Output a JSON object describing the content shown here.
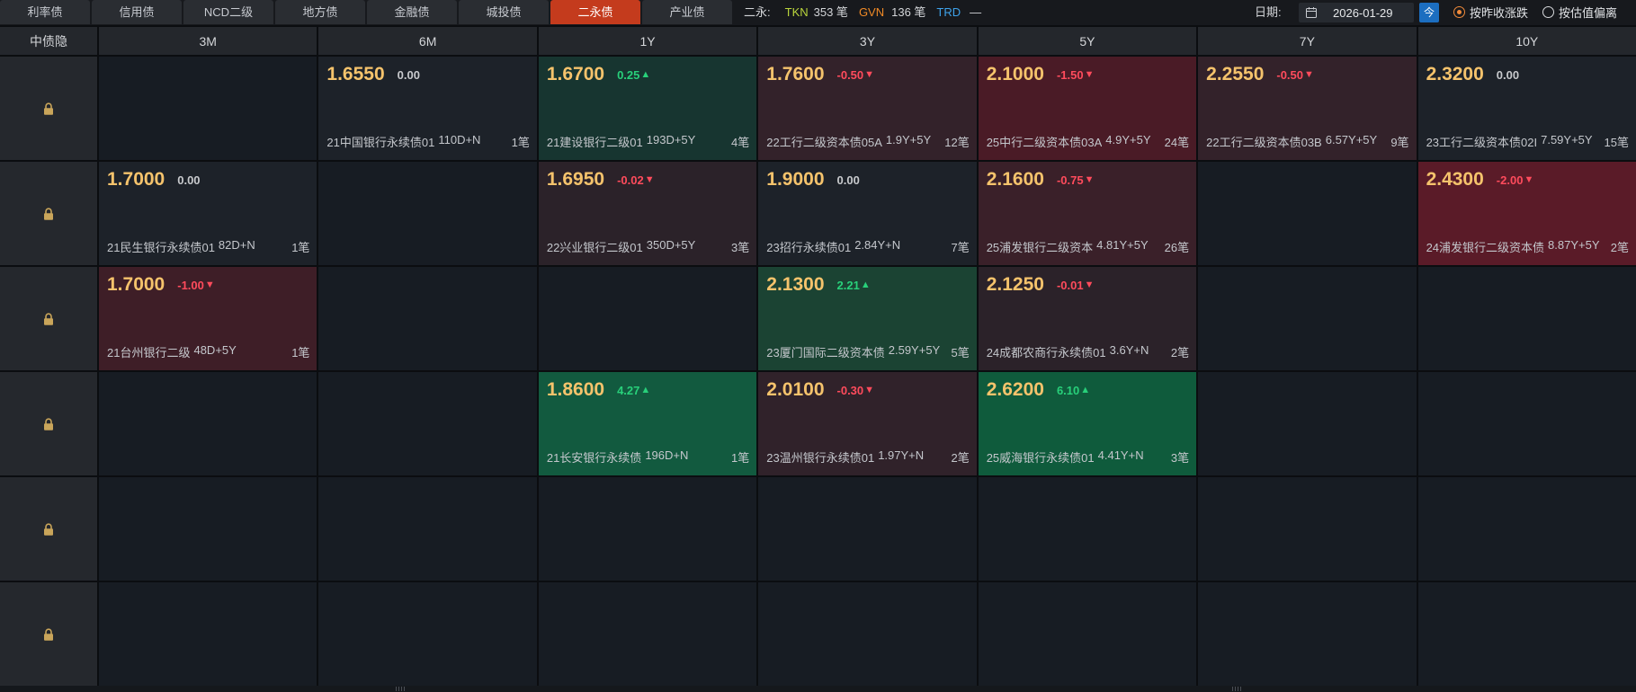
{
  "tabs": [
    {
      "label": "利率债",
      "active": false
    },
    {
      "label": "信用债",
      "active": false
    },
    {
      "label": "NCD二级",
      "active": false
    },
    {
      "label": "地方债",
      "active": false
    },
    {
      "label": "金融债",
      "active": false
    },
    {
      "label": "城投债",
      "active": false
    },
    {
      "label": "二永债",
      "active": true
    },
    {
      "label": "产业债",
      "active": false
    }
  ],
  "summary": {
    "label": "二永:",
    "tkn": {
      "name": "TKN",
      "count": "353 笔",
      "color": "#b9d43c"
    },
    "gvn": {
      "name": "GVN",
      "count": "136 笔",
      "color": "#f08a26"
    },
    "trd": {
      "name": "TRD",
      "value": "—",
      "color": "#3ea2ea"
    }
  },
  "date_picker": {
    "label": "日期:",
    "icon": "calendar-icon",
    "value": "2026-01-29",
    "today_button": "今"
  },
  "mode": {
    "options": [
      {
        "label": "按昨收涨跌",
        "selected": true
      },
      {
        "label": "按估值偏离",
        "selected": false
      }
    ]
  },
  "colors": {
    "accent": "#c43b1d",
    "price": "#f5c36c",
    "up": "#28d07a",
    "down": "#ff4b5c",
    "flat": "#c8cacd",
    "lock": "#c9a55a"
  },
  "grid": {
    "corner_label": "中债隐",
    "row_icon": "lock-icon",
    "columns": [
      "3M",
      "6M",
      "1Y",
      "3Y",
      "5Y",
      "7Y",
      "10Y"
    ],
    "rows": [
      {
        "cells": [
          null,
          {
            "price": "1.6550",
            "change": "0.00",
            "dir": "flat",
            "bond": "21中国银行永续债01",
            "term": "110D+N",
            "count": "1笔",
            "bg": "#1d2229"
          },
          {
            "price": "1.6700",
            "change": "0.25",
            "arrow": "▲",
            "dir": "up",
            "bond": "21建设银行二级01",
            "term": "193D+5Y",
            "count": "4笔",
            "bg": "#173530"
          },
          {
            "price": "1.7600",
            "change": "-0.50",
            "arrow": "▼",
            "dir": "down",
            "bond": "22工行二级资本债05A",
            "term": "1.9Y+5Y",
            "count": "12笔",
            "bg": "#33222a"
          },
          {
            "price": "2.1000",
            "change": "-1.50",
            "arrow": "▼",
            "dir": "down",
            "bond": "25中行二级资本债03A",
            "term": "4.9Y+5Y",
            "count": "24笔",
            "bg": "#4a1b26"
          },
          {
            "price": "2.2550",
            "change": "-0.50",
            "arrow": "▼",
            "dir": "down",
            "bond": "22工行二级资本债03B",
            "term": "6.57Y+5Y",
            "count": "9笔",
            "bg": "#33222a"
          },
          {
            "price": "2.3200",
            "change": "0.00",
            "dir": "flat",
            "bond": "23工行二级资本债02I",
            "term": "7.59Y+5Y",
            "count": "15笔",
            "bg": "#1d2229"
          }
        ]
      },
      {
        "cells": [
          {
            "price": "1.7000",
            "change": "0.00",
            "dir": "flat",
            "bond": "21民生银行永续债01",
            "term": "82D+N",
            "count": "1笔",
            "bg": "#1d2229"
          },
          null,
          {
            "price": "1.6950",
            "change": "-0.02",
            "arrow": "▼",
            "dir": "down",
            "bond": "22兴业银行二级01",
            "term": "350D+5Y",
            "count": "3笔",
            "bg": "#2b2229"
          },
          {
            "price": "1.9000",
            "change": "0.00",
            "dir": "flat",
            "bond": "23招行永续债01",
            "term": "2.84Y+N",
            "count": "7笔",
            "bg": "#1d2229"
          },
          {
            "price": "2.1600",
            "change": "-0.75",
            "arrow": "▼",
            "dir": "down",
            "bond": "25浦发银行二级资本",
            "term": "4.81Y+5Y",
            "count": "26笔",
            "bg": "#3a2029"
          },
          null,
          {
            "price": "2.4300",
            "change": "-2.00",
            "arrow": "▼",
            "dir": "down",
            "bond": "24浦发银行二级资本债",
            "term": "8.87Y+5Y",
            "count": "2笔",
            "bg": "#5a1b28"
          }
        ]
      },
      {
        "cells": [
          {
            "price": "1.7000",
            "change": "-1.00",
            "arrow": "▼",
            "dir": "down",
            "bond": "21台州银行二级",
            "term": "48D+5Y",
            "count": "1笔",
            "bg": "#3e1e27"
          },
          null,
          null,
          {
            "price": "2.1300",
            "change": "2.21",
            "arrow": "▲",
            "dir": "up",
            "bond": "23厦门国际二级资本债",
            "term": "2.59Y+5Y",
            "count": "5笔",
            "bg": "#1b4333"
          },
          {
            "price": "2.1250",
            "change": "-0.01",
            "arrow": "▼",
            "dir": "down",
            "bond": "24成都农商行永续债01",
            "term": "3.6Y+N",
            "count": "2笔",
            "bg": "#2b2229"
          },
          null,
          null
        ]
      },
      {
        "cells": [
          null,
          null,
          {
            "price": "1.8600",
            "change": "4.27",
            "arrow": "▲",
            "dir": "up",
            "bond": "21长安银行永续债",
            "term": "196D+N",
            "count": "1笔",
            "bg": "#125a3f"
          },
          {
            "price": "2.0100",
            "change": "-0.30",
            "arrow": "▼",
            "dir": "down",
            "bond": "23温州银行永续债01",
            "term": "1.97Y+N",
            "count": "2笔",
            "bg": "#30222a"
          },
          {
            "price": "2.6200",
            "change": "6.10",
            "arrow": "▲",
            "dir": "up",
            "bond": "25威海银行永续债01",
            "term": "4.41Y+N",
            "count": "3笔",
            "bg": "#0f5b3c"
          },
          null,
          null
        ]
      },
      {
        "cells": [
          null,
          null,
          null,
          null,
          null,
          null,
          null
        ]
      },
      {
        "cells": [
          null,
          null,
          null,
          null,
          null,
          null,
          null
        ]
      }
    ]
  }
}
